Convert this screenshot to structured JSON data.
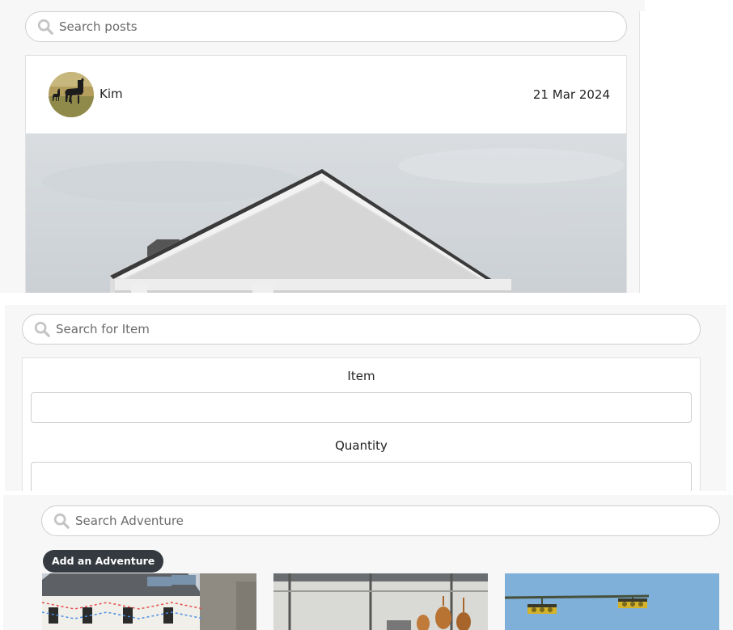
{
  "posts_panel": {
    "search": {
      "placeholder": "Search posts"
    },
    "post": {
      "author": "Kim",
      "date": "21 Mar 2024",
      "avatar_icon": "alpaca-avatar",
      "image": "white-gable-building-photo"
    }
  },
  "items_panel": {
    "search": {
      "placeholder": "Search for Item"
    },
    "form": {
      "item_label": "Item",
      "item_value": "",
      "quantity_label": "Quantity",
      "quantity_value": ""
    }
  },
  "adventures_panel": {
    "search": {
      "placeholder": "Search Adventure"
    },
    "add_button_label": "Add an Adventure",
    "cards": [
      {
        "image": "village-street-bunting-photo"
      },
      {
        "image": "distillery-copper-stills-photo"
      },
      {
        "image": "traffic-lights-blue-sky-photo"
      }
    ]
  },
  "colors": {
    "panel_bg": "#f7f7f7",
    "card_bg": "#ffffff",
    "border": "#cfcfcf",
    "button_bg": "#343a40",
    "button_text": "#ffffff"
  }
}
